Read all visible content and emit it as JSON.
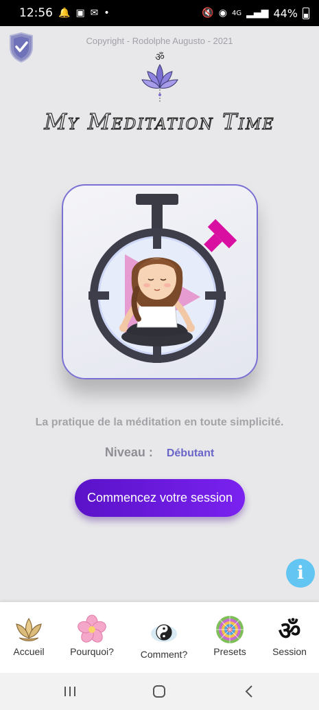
{
  "status_bar": {
    "time": "12:56",
    "battery": "44%",
    "network": "4G"
  },
  "header": {
    "copyright": "Copyright - Rodolphe Augusto - 2021",
    "app_title": "My Meditation Time"
  },
  "main": {
    "tagline": "La pratique de la méditation en toute simplicité.",
    "level_label": "Niveau :",
    "level_value": "Débutant",
    "start_button": "Commencez votre session"
  },
  "bottom_nav": {
    "items": [
      {
        "label": "Accueil",
        "icon": "lotus-icon"
      },
      {
        "label": "Pourquoi?",
        "icon": "flower-icon"
      },
      {
        "label": "Comment?",
        "icon": "yin-yang-icon"
      },
      {
        "label": "Presets",
        "icon": "mandala-icon"
      },
      {
        "label": "Session",
        "icon": "om-icon"
      }
    ]
  },
  "colors": {
    "accent": "#6a64c8",
    "button": "#6a1be0",
    "info": "#63c5f2",
    "background": "#e8e8ea"
  }
}
